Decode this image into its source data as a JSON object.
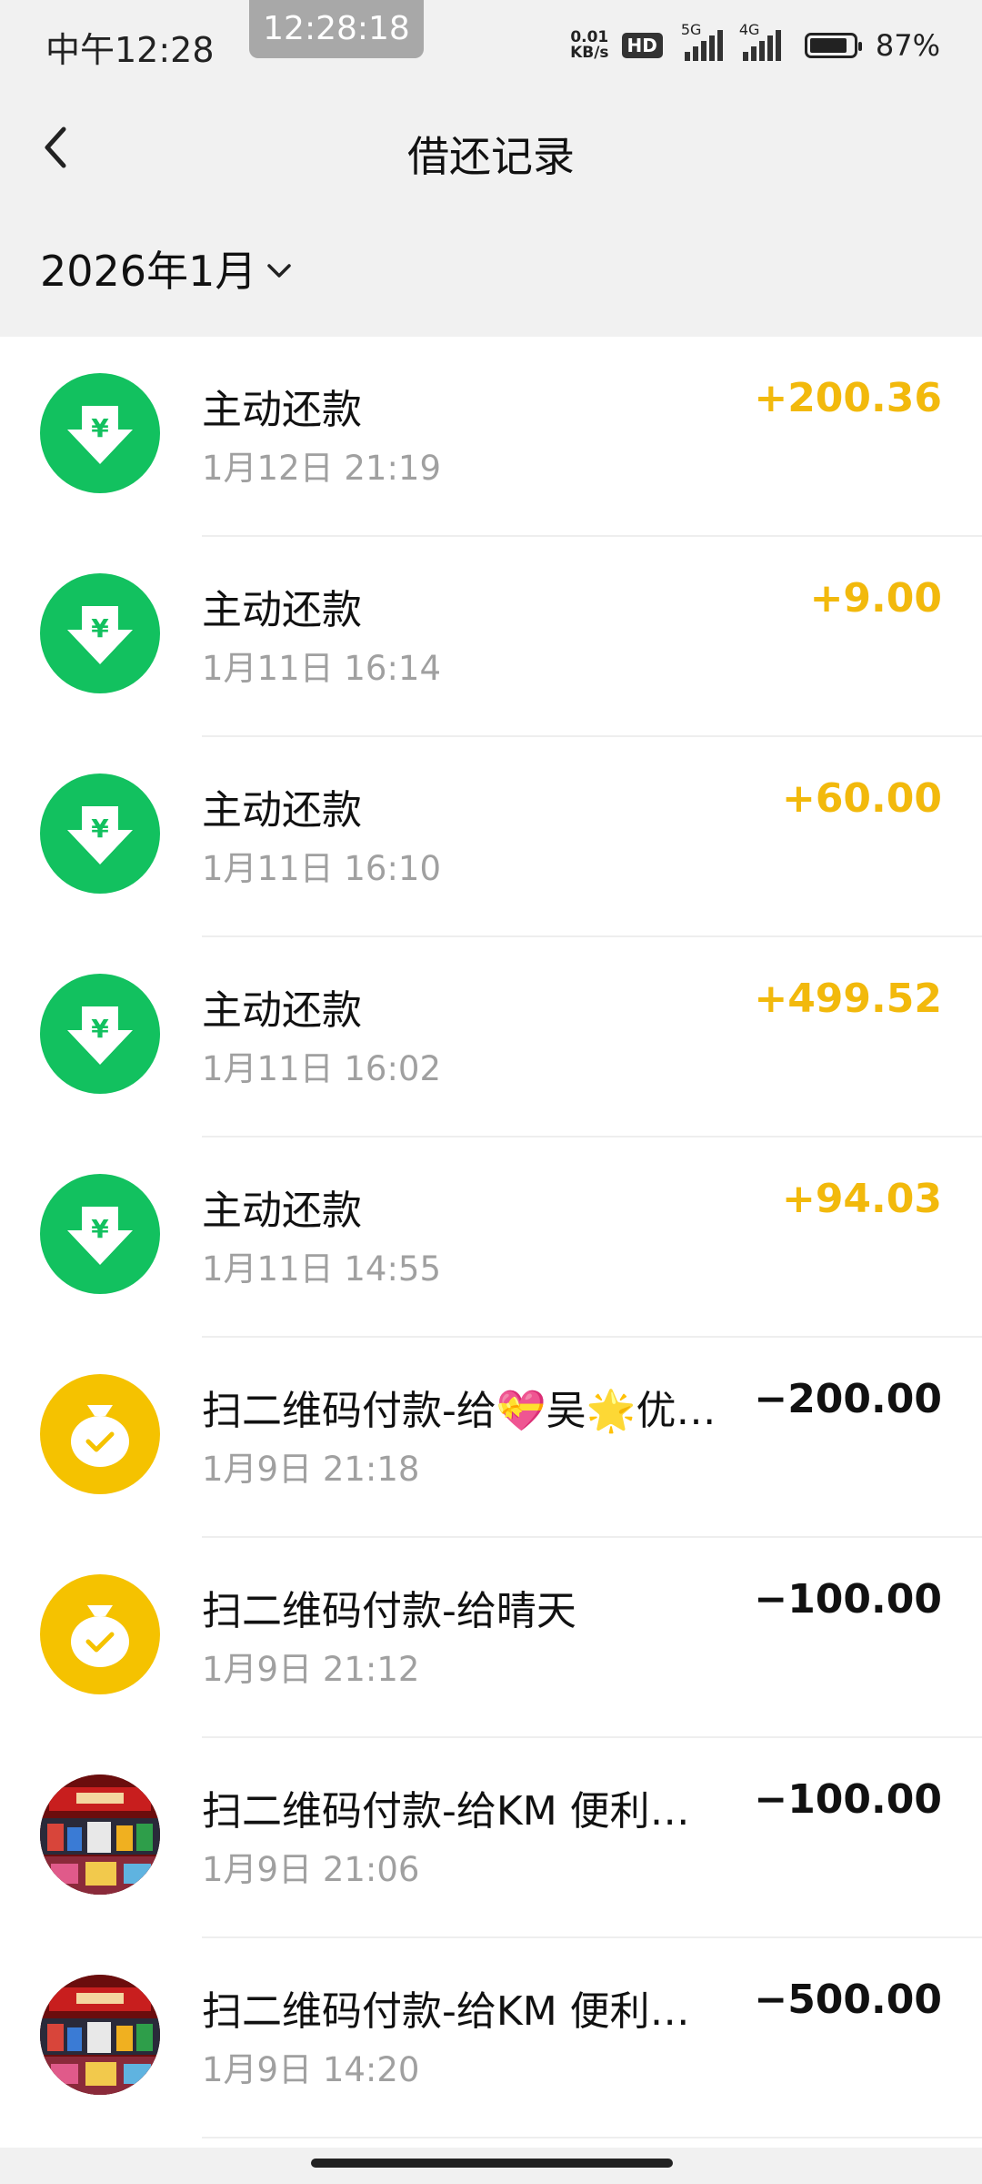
{
  "status_bar": {
    "time": "中午12:28",
    "pill_time": "12:28:18",
    "net_speed_value": "0.01",
    "net_speed_unit": "KB/s",
    "hd": "HD",
    "sim1": "5G",
    "sim2": "4G",
    "battery_percent": "87%",
    "battery_level": 0.87
  },
  "header": {
    "title": "借还记录",
    "month": "2026年1月"
  },
  "colors": {
    "green": "#12c15f",
    "yellow": "#f5c200",
    "positive_amount": "#f2b90c"
  },
  "records": [
    {
      "icon": "repay-arrow-icon",
      "type": "green",
      "title": "主动还款",
      "time": "1月12日 21:19",
      "amount": "+200.36",
      "sign": "pos"
    },
    {
      "icon": "repay-arrow-icon",
      "type": "green",
      "title": "主动还款",
      "time": "1月11日 16:14",
      "amount": "+9.00",
      "sign": "pos"
    },
    {
      "icon": "repay-arrow-icon",
      "type": "green",
      "title": "主动还款",
      "time": "1月11日 16:10",
      "amount": "+60.00",
      "sign": "pos"
    },
    {
      "icon": "repay-arrow-icon",
      "type": "green",
      "title": "主动还款",
      "time": "1月11日 16:02",
      "amount": "+499.52",
      "sign": "pos"
    },
    {
      "icon": "repay-arrow-icon",
      "type": "green",
      "title": "主动还款",
      "time": "1月11日 14:55",
      "amount": "+94.03",
      "sign": "pos"
    },
    {
      "icon": "money-bag-icon",
      "type": "yellow",
      "title": "扫二维码付款-给💝吴🌟优…",
      "time": "1月9日 21:18",
      "amount": "−200.00",
      "sign": "neg"
    },
    {
      "icon": "money-bag-icon",
      "type": "yellow",
      "title": "扫二维码付款-给晴天",
      "time": "1月9日 21:12",
      "amount": "−100.00",
      "sign": "neg"
    },
    {
      "icon": "store-photo",
      "type": "photo",
      "title": "扫二维码付款-给KM 便利…",
      "time": "1月9日 21:06",
      "amount": "−100.00",
      "sign": "neg"
    },
    {
      "icon": "store-photo",
      "type": "photo",
      "title": "扫二维码付款-给KM 便利…",
      "time": "1月9日 14:20",
      "amount": "−500.00",
      "sign": "neg"
    }
  ]
}
